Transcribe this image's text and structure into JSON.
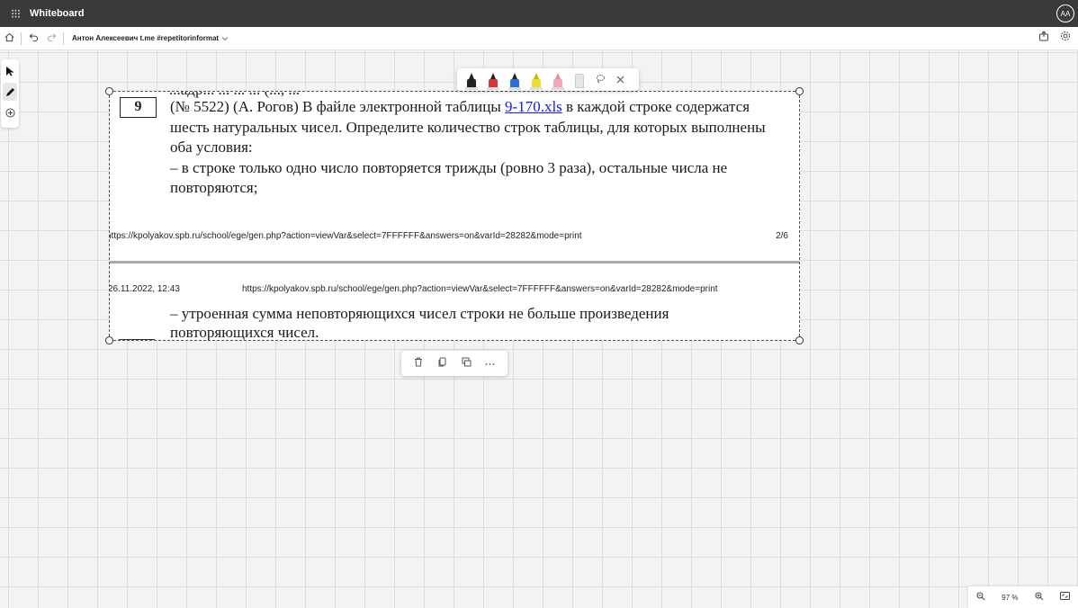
{
  "app": {
    "title": "Whiteboard",
    "avatar_initials": "AA"
  },
  "commandbar": {
    "board_name": "Антон Алексеевич t.me #repetitorinformat",
    "icons": [
      "home-icon",
      "undo-icon",
      "redo-icon",
      "chevron-down-icon",
      "share-icon",
      "settings-icon"
    ]
  },
  "tools": [
    "select-tool",
    "pen-tool",
    "add-tool"
  ],
  "pens": [
    {
      "name": "black-pen",
      "color": "#222222"
    },
    {
      "name": "red-pen",
      "color": "#d83434"
    },
    {
      "name": "blue-pen",
      "color": "#2a6fd6"
    },
    {
      "name": "yellow-highlighter",
      "color": "#f2dc2a"
    },
    {
      "name": "pink-highlighter",
      "color": "#f3a6b6"
    },
    {
      "name": "eraser",
      "color": "#e6e6e6"
    }
  ],
  "document": {
    "cut_top_line": "...адр... ... ... ... (..., ...",
    "task_number": "9",
    "para1_prefix": "(№ 5522) (А. Рогов) В файле электронной таблицы ",
    "para1_link": "9-170.xls",
    "para1_suffix": " в каждой строке содержатся",
    "line2": "шесть натуральных чисел. Определите количество строк таблицы, для которых выполнены",
    "line3": "оба условия:",
    "line4": "– в строке только одно число повторяется трижды (ровно 3 раза), остальные числа не",
    "line5": "повторяются;",
    "footer_url": "https://kpolyakov.spb.ru/school/ege/gen.php?action=viewVar&select=7FFFFFF&answers=on&varId=28282&mode=print",
    "footer_page": "2/6",
    "header_date": "26.11.2022, 12:43",
    "header_url": "https://kpolyakov.spb.ru/school/ege/gen.php?action=viewVar&select=7FFFFFF&answers=on&varId=28282&mode=print",
    "line6": "– утроенная сумма неповторяющихся чисел строки не больше произведения",
    "line7": "повторяющихся чисел."
  },
  "context_menu": [
    "delete-icon",
    "copy-icon",
    "duplicate-icon",
    "more-icon"
  ],
  "zoom": {
    "level": "97 %"
  }
}
